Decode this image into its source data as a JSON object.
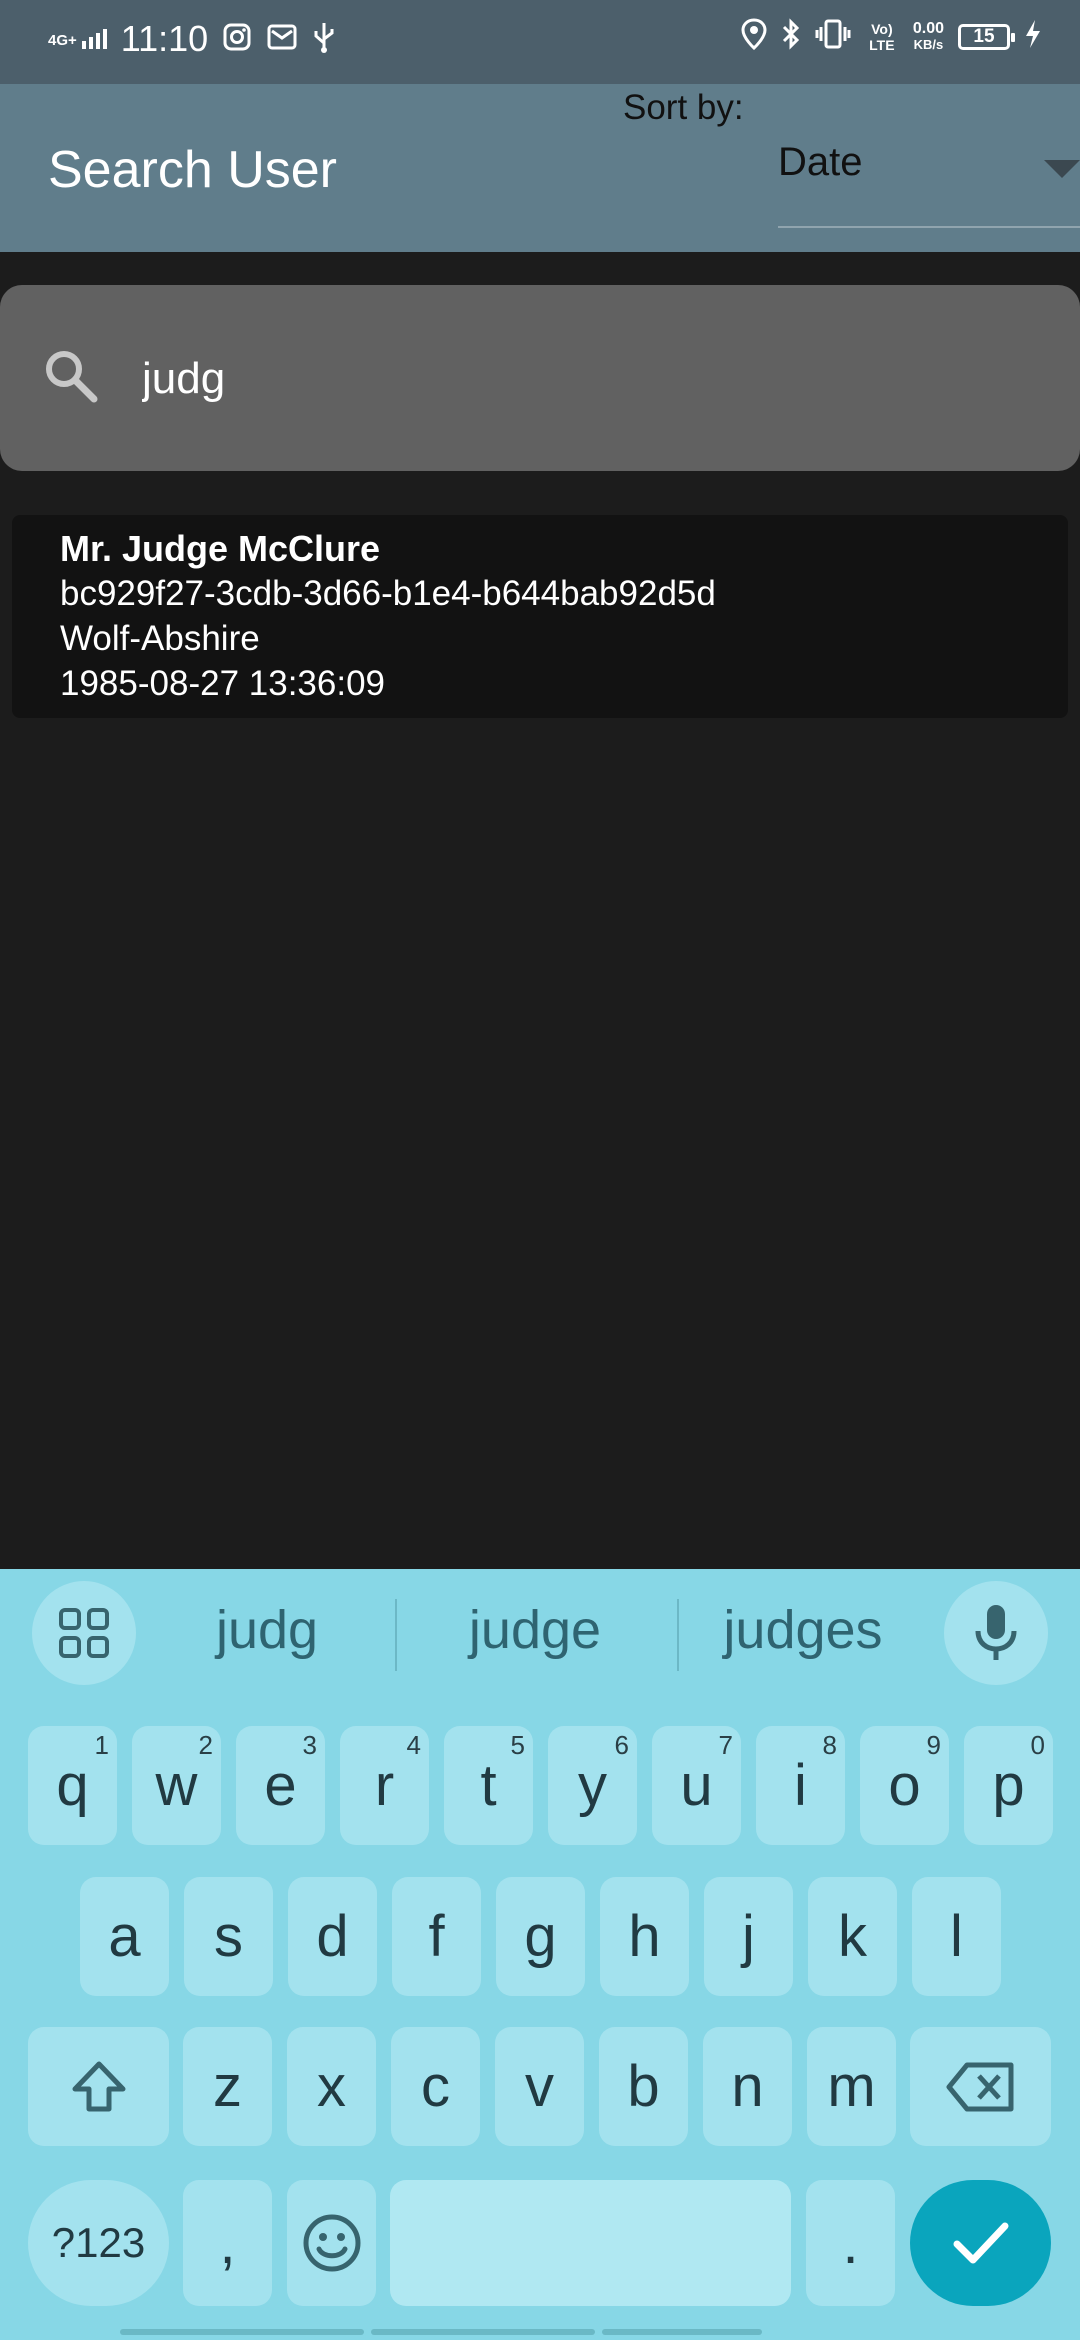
{
  "status_bar": {
    "network": "4G+",
    "time": "11:10",
    "volte": "Vo) LTE",
    "speed_value": "0.00",
    "speed_unit": "KB/s",
    "battery": "15",
    "icons": [
      "instagram-icon",
      "mail-icon",
      "usb-icon",
      "location-icon",
      "bluetooth-icon",
      "vibrate-icon",
      "charging-icon"
    ]
  },
  "app_bar": {
    "title": "Search User",
    "sort_label": "Sort by:",
    "sort_value": "Date"
  },
  "search": {
    "value": "judg",
    "placeholder": ""
  },
  "results": [
    {
      "name": "Mr. Judge McClure",
      "id": "bc929f27-3cdb-3d66-b1e4-b644bab92d5d",
      "company": "Wolf-Abshire",
      "date": "1985-08-27 13:36:09"
    }
  ],
  "keyboard": {
    "suggestions": [
      "judg",
      "judge",
      "judges"
    ],
    "row1": [
      {
        "k": "q",
        "n": "1"
      },
      {
        "k": "w",
        "n": "2"
      },
      {
        "k": "e",
        "n": "3"
      },
      {
        "k": "r",
        "n": "4"
      },
      {
        "k": "t",
        "n": "5"
      },
      {
        "k": "y",
        "n": "6"
      },
      {
        "k": "u",
        "n": "7"
      },
      {
        "k": "i",
        "n": "8"
      },
      {
        "k": "o",
        "n": "9"
      },
      {
        "k": "p",
        "n": "0"
      }
    ],
    "row2": [
      "a",
      "s",
      "d",
      "f",
      "g",
      "h",
      "j",
      "k",
      "l"
    ],
    "row3": [
      "z",
      "x",
      "c",
      "v",
      "b",
      "n",
      "m"
    ],
    "symbols_key": "?123",
    "comma_key": ",",
    "period_key": "."
  },
  "colors": {
    "app_bar": "#607d8b",
    "status_bar": "#4c5f6b",
    "keyboard_bg": "#87d7e6",
    "enter_key": "#0aa5bd"
  }
}
